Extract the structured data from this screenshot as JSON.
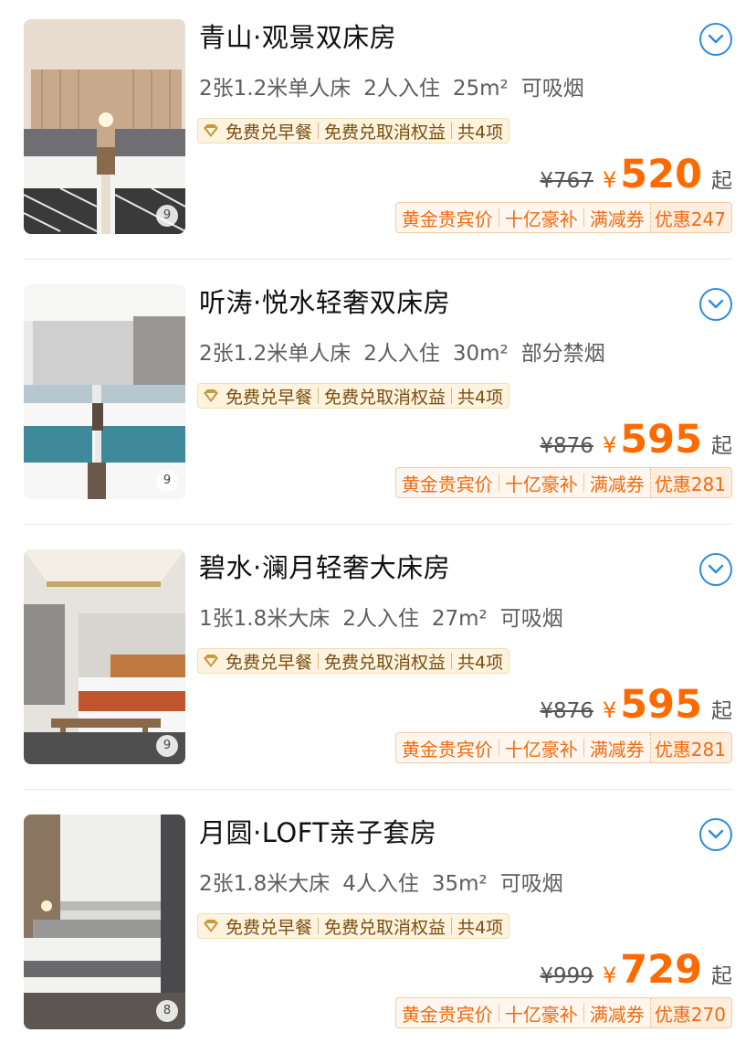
{
  "rooms": [
    {
      "name": "青山·观景双床房",
      "bed": "2张1.2米单人床",
      "guests": "2人入住",
      "area": "25m²",
      "smoking": "可吸烟",
      "perks": [
        "免费兑早餐",
        "免费兑取消权益",
        "共4项"
      ],
      "original_price": "¥767",
      "currency": "¥",
      "price": "520",
      "price_suffix": "起",
      "promo_tags": [
        "黄金贵宾价",
        "十亿豪补",
        "满减券"
      ],
      "discount": "优惠247",
      "photo_count": "9"
    },
    {
      "name": "听涛·悦水轻奢双床房",
      "bed": "2张1.2米单人床",
      "guests": "2人入住",
      "area": "30m²",
      "smoking": "部分禁烟",
      "perks": [
        "免费兑早餐",
        "免费兑取消权益",
        "共4项"
      ],
      "original_price": "¥876",
      "currency": "¥",
      "price": "595",
      "price_suffix": "起",
      "promo_tags": [
        "黄金贵宾价",
        "十亿豪补",
        "满减券"
      ],
      "discount": "优惠281",
      "photo_count": "9"
    },
    {
      "name": "碧水·澜月轻奢大床房",
      "bed": "1张1.8米大床",
      "guests": "2人入住",
      "area": "27m²",
      "smoking": "可吸烟",
      "perks": [
        "免费兑早餐",
        "免费兑取消权益",
        "共4项"
      ],
      "original_price": "¥876",
      "currency": "¥",
      "price": "595",
      "price_suffix": "起",
      "promo_tags": [
        "黄金贵宾价",
        "十亿豪补",
        "满减券"
      ],
      "discount": "优惠281",
      "photo_count": "9"
    },
    {
      "name": "月圆·LOFT亲子套房",
      "bed": "2张1.8米大床",
      "guests": "4人入住",
      "area": "35m²",
      "smoking": "可吸烟",
      "perks": [
        "免费兑早餐",
        "免费兑取消权益",
        "共4项"
      ],
      "original_price": "¥999",
      "currency": "¥",
      "price": "729",
      "price_suffix": "起",
      "promo_tags": [
        "黄金贵宾价",
        "十亿豪补",
        "满减券"
      ],
      "discount": "优惠270",
      "photo_count": "8"
    }
  ],
  "icons": {
    "expand": "chevron-down-circle-icon",
    "perk": "diamond-icon"
  },
  "colors": {
    "accent": "#ff6a00",
    "link": "#2b8be0",
    "perk_bg": "#fdf3df",
    "perk_text": "#7a4e10"
  }
}
